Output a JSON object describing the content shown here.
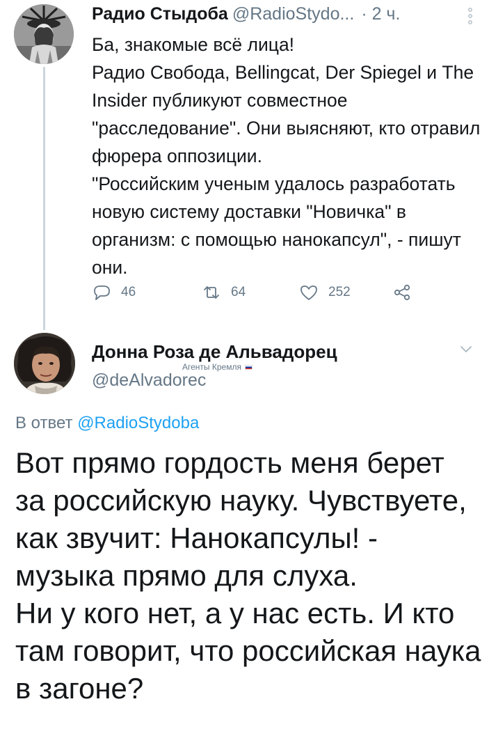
{
  "tweet1": {
    "author_name": "Радио Стыдоба",
    "handle": "@RadioStydo...",
    "time": "· 2 ч.",
    "text": "Ба, знакомые всё лица!\nРадио Свобода, Bellingcat, Der Spiegel и The Insider публикуют совместное \"расследование\". Они выясняют, кто отравил фюрера оппозиции.\n\"Российским ученым удалось разработать новую систему доставки \"Новичка\" в организм: с помощью нанокапсул\", - пишут они.",
    "replies": "46",
    "retweets": "64",
    "likes": "252"
  },
  "tweet2": {
    "author_name": "Донна Роза де Альвадорец",
    "badge": "Агенты Кремля",
    "handle": "@deAlvadorec",
    "reply_prefix": "В ответ",
    "reply_mention": "@RadioStydoba",
    "text": "Вот прямо гордость меня берет за российскую науку. Чувствуете, как звучит: Нанокапсулы! - музыка прямо для слуха.\nНи у кого нет, а у нас есть. И кто там говорит, что российская наука в загоне?"
  },
  "icons": {
    "reply": "speech-bubble-icon",
    "retweet": "retweet-icon",
    "like": "heart-icon",
    "share": "share-icon",
    "more": "vertical-dots-icon",
    "caret": "chevron-down-icon"
  },
  "colors": {
    "text": "#14171a",
    "secondary": "#657786",
    "link": "#1da1f2",
    "thread_line": "#ccd6dd"
  }
}
